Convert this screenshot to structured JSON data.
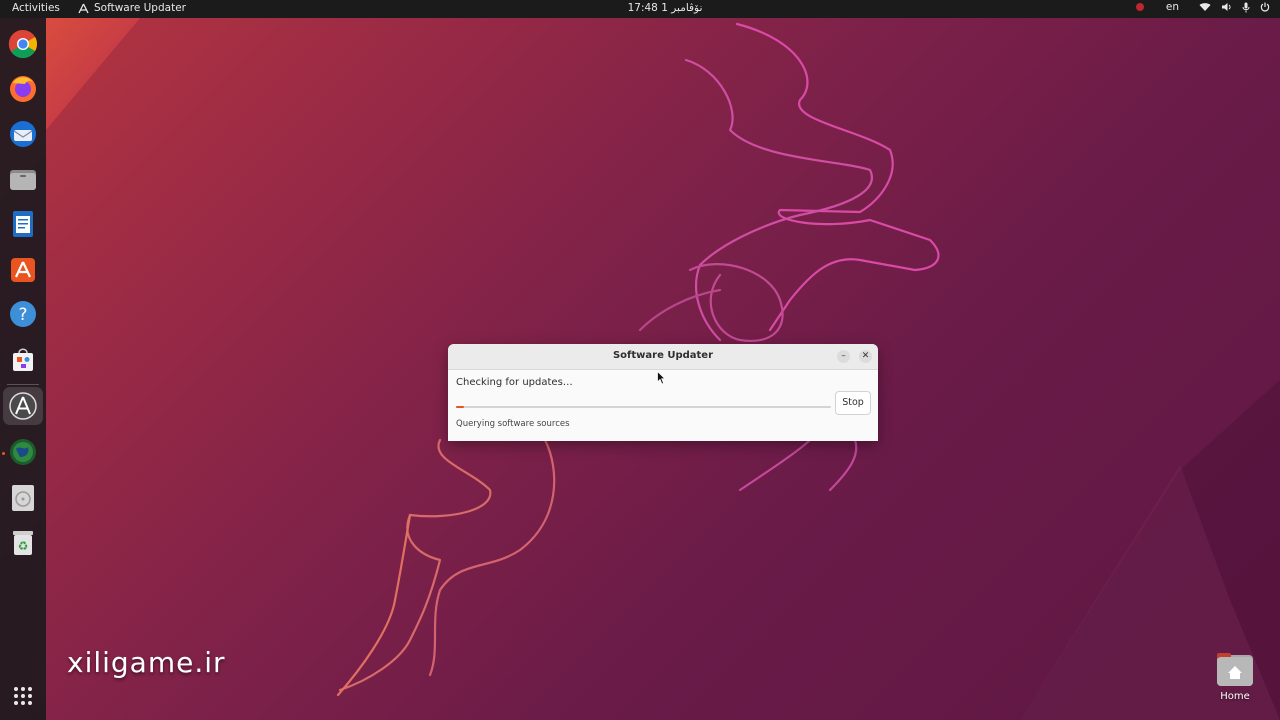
{
  "topbar": {
    "activities": "Activities",
    "app_name": "Software Updater",
    "clock": "17:48 نۆڤامبر 1",
    "language": "en",
    "icons": [
      "record-indicator-icon",
      "wifi-icon",
      "volume-icon",
      "microphone-icon",
      "power-icon"
    ]
  },
  "dock": {
    "items": [
      {
        "name": "Google Chrome",
        "icon": "chrome-icon"
      },
      {
        "name": "Firefox",
        "icon": "firefox-icon"
      },
      {
        "name": "Thunderbird",
        "icon": "thunderbird-icon"
      },
      {
        "name": "Files",
        "icon": "files-icon"
      },
      {
        "name": "LibreOffice Writer",
        "icon": "writer-icon"
      },
      {
        "name": "Ubuntu Software",
        "icon": "ubuntu-software-icon"
      },
      {
        "name": "Help",
        "icon": "help-icon"
      },
      {
        "name": "Software Store",
        "icon": "store-icon"
      },
      {
        "name": "Software Updater",
        "icon": "software-updater-icon",
        "active": true
      },
      {
        "name": "Globe App",
        "icon": "globe-icon"
      },
      {
        "name": "Disc",
        "icon": "disc-icon"
      },
      {
        "name": "Trash",
        "icon": "trash-icon"
      }
    ],
    "show_apps_icon": "app-grid-icon"
  },
  "desktop": {
    "home_label": "Home",
    "watermark": "xiligame.ir"
  },
  "dialog": {
    "title": "Software Updater",
    "status": "Checking for updates…",
    "progress": 0.02,
    "stop_label": "Stop",
    "detail": "Querying software sources",
    "minimize_glyph": "–",
    "close_glyph": "✕"
  },
  "colors": {
    "accent": "#e95420",
    "topbar": "#1b1b1b",
    "dialog_bg": "#fafafa"
  }
}
